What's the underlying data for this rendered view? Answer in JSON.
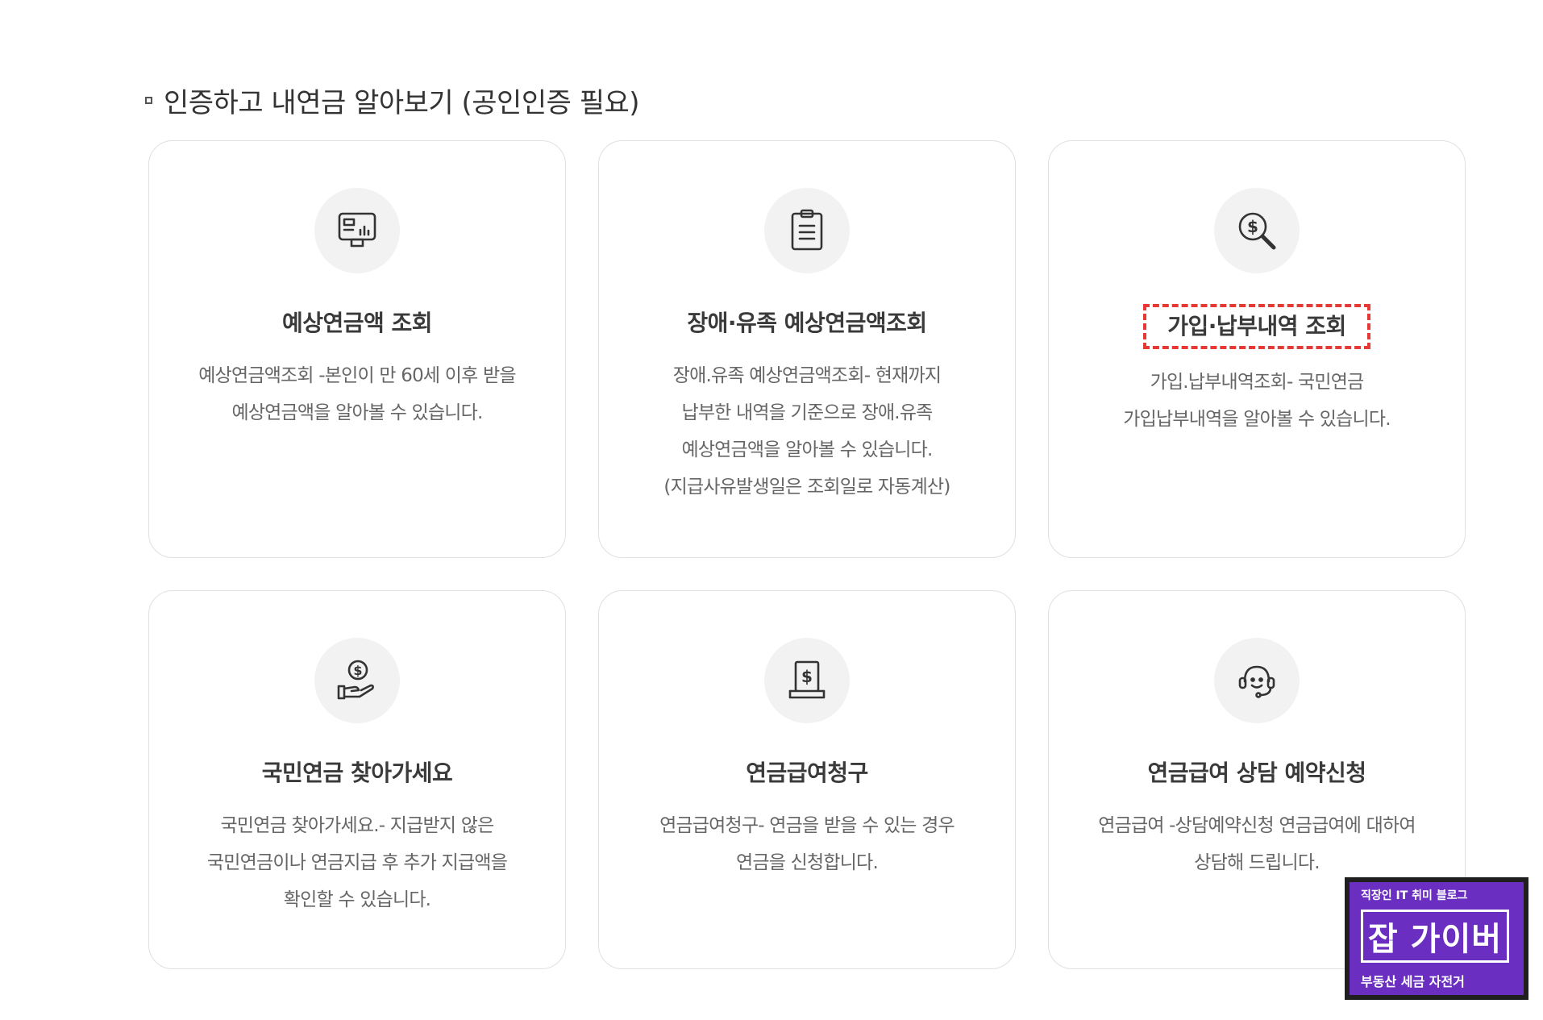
{
  "section_title": "인증하고 내연금 알아보기 (공인인증 필요)",
  "cards": [
    {
      "icon": "monitor-chart-icon",
      "title": "예상연금액 조회",
      "desc": [
        "예상연금액조회 -본인이 만 60세 이후 받을",
        "예상연금액을 알아볼 수 있습니다."
      ]
    },
    {
      "icon": "clipboard-icon",
      "title": "장애·유족 예상연금액조회",
      "desc": [
        "장애.유족 예상연금액조회- 현재까지",
        "납부한 내역을 기준으로 장애.유족",
        "예상연금액을 알아볼 수 있습니다.",
        "(지급사유발생일은 조회일로 자동계산)"
      ]
    },
    {
      "icon": "dollar-search-icon",
      "title": "가입·납부내역 조회",
      "desc": [
        "가입.납부내역조회- 국민연금",
        "가입납부내역을 알아볼 수 있습니다."
      ]
    },
    {
      "icon": "hand-coin-icon",
      "title": "국민연금 찾아가세요",
      "desc": [
        "국민연금 찾아가세요.- 지급받지 않은",
        "국민연금이나 연금지급 후 추가 지급액을",
        "확인할 수 있습니다."
      ]
    },
    {
      "icon": "dollar-document-icon",
      "title": "연금급여청구",
      "desc": [
        "연금급여청구- 연금을 받을 수 있는 경우",
        "연금을 신청합니다."
      ]
    },
    {
      "icon": "headset-icon",
      "title": "연금급여 상담 예약신청",
      "desc": [
        "연금급여 -상담예약신청 연금급여에 대하여",
        "상담해 드립니다."
      ]
    }
  ],
  "badge": {
    "top": "직장인 IT 취미 블로그",
    "main": "잡 가이버",
    "bottom": "부동산 세금 자전거"
  },
  "colors": {
    "highlight": "#e53935",
    "badge_purple": "#6a2fc0"
  }
}
